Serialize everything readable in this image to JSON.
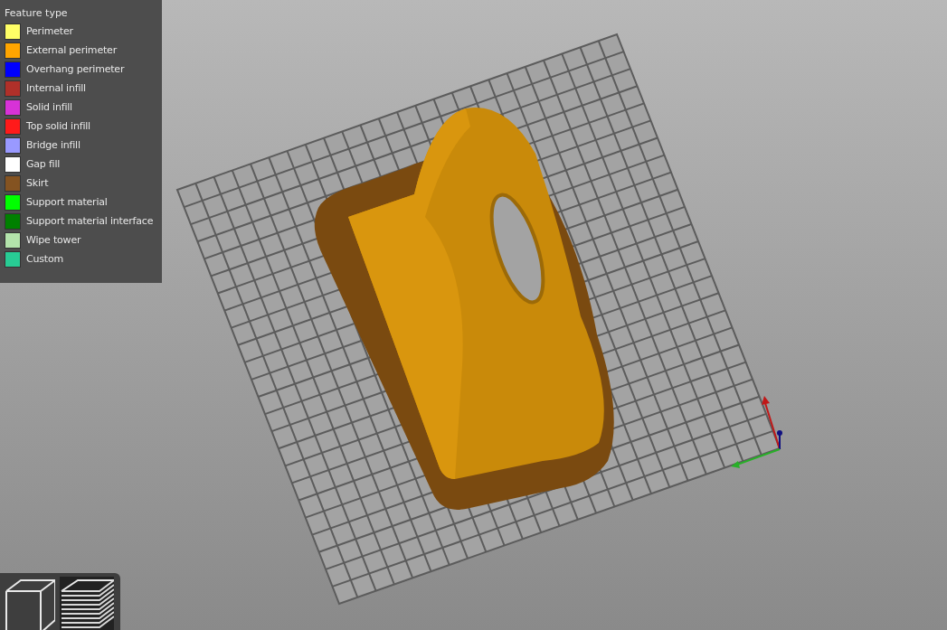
{
  "legend": {
    "title": "Feature type",
    "items": [
      {
        "label": "Perimeter",
        "color": "#ffff66"
      },
      {
        "label": "External perimeter",
        "color": "#ffa500"
      },
      {
        "label": "Overhang perimeter",
        "color": "#0000ff"
      },
      {
        "label": "Internal infill",
        "color": "#b03029"
      },
      {
        "label": "Solid infill",
        "color": "#d732d7"
      },
      {
        "label": "Top solid infill",
        "color": "#ff1a1a"
      },
      {
        "label": "Bridge infill",
        "color": "#9999ff"
      },
      {
        "label": "Gap fill",
        "color": "#ffffff"
      },
      {
        "label": "Skirt",
        "color": "#845321"
      },
      {
        "label": "Support material",
        "color": "#00ff00"
      },
      {
        "label": "Support material interface",
        "color": "#008000"
      },
      {
        "label": "Wipe tower",
        "color": "#b3e3ab"
      },
      {
        "label": "Custom",
        "color": "#28cc94"
      }
    ]
  },
  "view_buttons": [
    {
      "kind": "solid",
      "selected": false
    },
    {
      "kind": "preview",
      "selected": true
    }
  ]
}
